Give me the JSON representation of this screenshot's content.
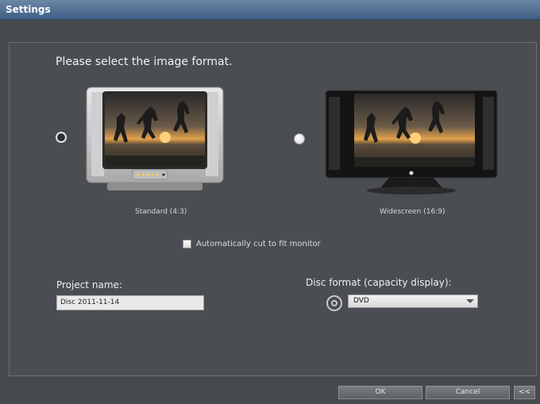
{
  "window": {
    "title": "Settings"
  },
  "format": {
    "heading": "Please select the image format.",
    "standard_label": "Standard (4:3)",
    "widescreen_label": "Widescreen (16:9)",
    "selected": "standard"
  },
  "options": {
    "auto_cut_label": "Automatically cut to fit monitor",
    "auto_cut_checked": false
  },
  "project": {
    "label": "Project name:",
    "value": "Disc 2011-11-14"
  },
  "disc": {
    "label": "Disc format (capacity display):",
    "selected": "DVD"
  },
  "buttons": {
    "ok": "OK",
    "cancel": "Cancel",
    "collapse": "<<"
  }
}
